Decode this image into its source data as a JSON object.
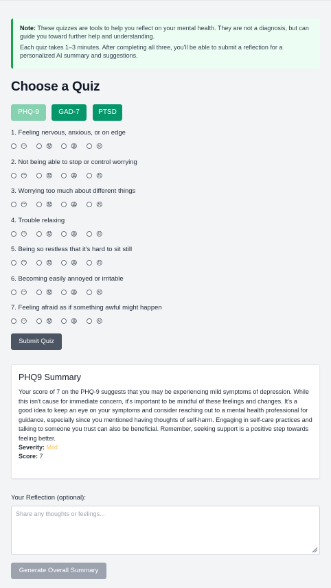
{
  "note": {
    "label": "Note:",
    "text": " These quizzes are tools to help you reflect on your mental health. They are not a diagnosis, but can guide you toward further help and understanding.",
    "text2": "Each quiz takes 1–3 minutes. After completing all three, you'll be able to submit a reflection for a personalized AI summary and suggestions."
  },
  "title": "Choose a Quiz",
  "tabs": [
    {
      "label": "PHQ-9",
      "active": true
    },
    {
      "label": "GAD-7",
      "active": false
    },
    {
      "label": "PTSD",
      "active": false
    }
  ],
  "options": [
    {
      "emoji": "😶"
    },
    {
      "emoji": "😟"
    },
    {
      "emoji": "😩"
    },
    {
      "emoji": "😣"
    }
  ],
  "questions": [
    "1. Feeling nervous, anxious, or on edge",
    "2. Not being able to stop or control worrying",
    "3. Worrying too much about different things",
    "4. Trouble relaxing",
    "5. Being so restless that it's hard to sit still",
    "6. Becoming easily annoyed or irritable",
    "7. Feeling afraid as if something awful might happen"
  ],
  "submit_label": "Submit Quiz",
  "summary": {
    "title": "PHQ9 Summary",
    "text": "Your score of 7 on the PHQ-9 suggests that you may be experiencing mild symptoms of depression. While this isn't cause for immediate concern, it's important to be mindful of these feelings and changes. It's a good idea to keep an eye on your symptoms and consider reaching out to a mental health professional for guidance, especially since you mentioned having thoughts of self-harm. Engaging in self-care practices and talking to someone you trust can also be beneficial. Remember, seeking support is a positive step towards feeling better.",
    "severity_label": "Severity:",
    "severity_value": "Mild",
    "score_label": "Score:",
    "score_value": "7"
  },
  "reflection": {
    "label": "Your Reflection (optional):",
    "placeholder": "Share any thoughts or feelings..."
  },
  "generate_label": "Generate Overall Summary",
  "colors": {
    "tab_active": "#86d1b0",
    "tab": "#059669",
    "note_accent": "#16a34a",
    "severity": "#f6c453"
  }
}
